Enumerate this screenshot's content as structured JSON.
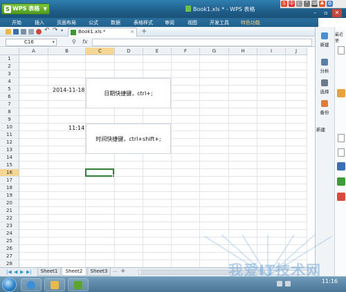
{
  "titlebar": {
    "app_menu_label": "WPS 表格",
    "window_title": "Book1.xls * - WPS 表格"
  },
  "menubar": {
    "items": [
      "开始",
      "插入",
      "页面布局",
      "公式",
      "数据",
      "表格样式",
      "审阅",
      "视图",
      "开发工具",
      "特色功能"
    ]
  },
  "toolbar": {
    "doc_tab": "Book1.xls *",
    "doc_close": "×",
    "new_tab": "+"
  },
  "formula_bar": {
    "cell_ref": "C16",
    "fx_label": "fx",
    "formula_value": ""
  },
  "grid": {
    "columns": [
      "A",
      "B",
      "C",
      "D",
      "E",
      "F",
      "G",
      "H",
      "I",
      "J"
    ],
    "active_column": "C",
    "rows": [
      "1",
      "2",
      "3",
      "4",
      "5",
      "6",
      "7",
      "8",
      "9",
      "10",
      "11",
      "12",
      "13",
      "14",
      "15",
      "16",
      "17",
      "18",
      "19",
      "20",
      "21",
      "22",
      "23",
      "24",
      "25",
      "26",
      "27",
      "28"
    ],
    "active_row": "16",
    "cells": {
      "B5": "2014-11-18",
      "B10": "11:14",
      "C5_merged": "日期快捷键，ctrl+;",
      "C10_merged": "时间快捷键，ctrl+shift+;"
    },
    "selected_cell": "C16"
  },
  "sheets": {
    "tabs": [
      "Sheet1",
      "Sheet2",
      "Sheet3"
    ],
    "active": "Sheet2",
    "add": "+",
    "more": "···"
  },
  "task_pane": {
    "buttons": [
      "新建",
      "分析",
      "选择",
      "备份"
    ],
    "strip_label": "最近使",
    "section_label": "新建"
  },
  "taskbar": {
    "time": "11:16"
  },
  "watermark": {
    "text": "我爱IT技术网",
    "url": "www.52ij.com"
  },
  "colors": {
    "title_bar": "#1f5e8a",
    "app_button": "#5aa62a",
    "active_header": "#f5d693",
    "selection_border": "#2f7d32"
  }
}
